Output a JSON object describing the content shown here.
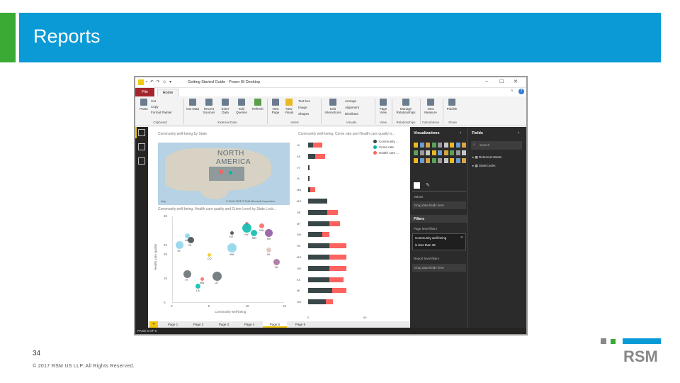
{
  "slide": {
    "title": "Reports",
    "page_number": "34",
    "copyright": "© 2017 RSM US LLP. All Rights Reserved.",
    "logo_text": "RSM",
    "colors": {
      "green": "#3aaa35",
      "blue": "#0a9ad6",
      "gray": "#888888"
    }
  },
  "app": {
    "window_title": "Getting Started Guide - Power BI Desktop",
    "tabs": {
      "file": "File",
      "home": "Home"
    },
    "ribbon": {
      "paste": "Paste",
      "cut": "Cut",
      "copy": "Copy",
      "format_painter": "Format Painter",
      "get_data": "Get Data",
      "recent_sources": "Recent Sources",
      "enter_data": "Enter Data",
      "edit_queries": "Edit Queries",
      "refresh": "Refresh",
      "new_page": "New Page",
      "new_visual": "New Visual",
      "text_box": "Text box",
      "image": "Image",
      "shapes": "Shapes",
      "edit_interactions": "Edit Interactions",
      "arrange": "Arrange",
      "alignment": "Alignment",
      "distribute": "Distribute",
      "page_view": "Page View",
      "manage_relationships": "Manage Relationships",
      "new_measure": "New Measure",
      "publish": "Publish",
      "groups": {
        "clipboard": "Clipboard",
        "external_data": "External Data",
        "insert": "Insert",
        "visuals": "Visuals",
        "view": "View",
        "relationships": "Relationships",
        "calculations": "Calculations",
        "share": "Share"
      }
    },
    "visuals": {
      "map_title": "Community well-being by State",
      "map_label": "NORTH AMERICA",
      "map_footer": "© 2016 HERE © 2016 Microsoft Corporation",
      "map_brand": "bing",
      "scatter_title": "Community well-being, Health care quality and Crime Level by State Lock...",
      "scatter_xlabel": "Community well-being",
      "scatter_ylabel": "Health care quality",
      "bar_title": "Community well-being, Crime rate and Health care quality b...",
      "legend": [
        "Community ...",
        "Crime rate",
        "Health care ..."
      ]
    },
    "page_tabs": [
      "Page 1",
      "Page 2",
      "Page 3",
      "Page 4",
      "Page 5",
      "Page 6"
    ],
    "status": "PAGE 5 OF 6",
    "viz_pane": {
      "title": "Visualizations",
      "values_label": "Values",
      "values_placeholder": "Drag data fields here",
      "filters_title": "Filters",
      "page_filters": "Page level filters",
      "filter_name": "Community well-being",
      "filter_condition": "is less than 36",
      "report_filters": "Report level filters",
      "report_placeholder": "Drag data fields here"
    },
    "fields_pane": {
      "title": "Fields",
      "search_placeholder": "Search",
      "tables": [
        "RetirementStats",
        "StateCodes"
      ]
    }
  },
  "chart_data": [
    {
      "type": "bar",
      "title": "Community well-being, Crime rate and Health care quality b...",
      "categories": [
        "HI",
        "AK",
        "VT",
        "IA",
        "MN",
        "MO",
        "DE",
        "MT",
        "WA",
        "PA",
        "MO",
        "OR",
        "KS",
        "MI",
        "WS"
      ],
      "series": [
        {
          "name": "Community ...",
          "color": "#3a4749",
          "values": [
            4,
            6,
            1,
            1,
            2,
            16,
            16,
            18,
            12,
            18,
            18,
            18,
            18,
            20,
            15
          ]
        },
        {
          "name": "Crime rate",
          "color": "#00b294",
          "values": [
            0,
            0,
            0,
            0,
            0,
            0,
            0,
            0,
            0,
            0,
            0,
            0,
            0,
            0,
            0
          ]
        },
        {
          "name": "Health care ...",
          "color": "#fd625e",
          "values": [
            8,
            8,
            0,
            0,
            4,
            0,
            9,
            9,
            6,
            14,
            14,
            14,
            12,
            12,
            6
          ]
        }
      ],
      "xlim": [
        0,
        50
      ],
      "ticks": [
        "0",
        "50"
      ]
    },
    {
      "type": "scatter",
      "title": "Community well-being, Health care quality and Crime Level by State Lock...",
      "xlabel": "Community well-being",
      "ylabel": "Health care quality",
      "xlim": [
        0,
        15
      ],
      "ylim": [
        0,
        36
      ],
      "xticks": [
        "0",
        "5",
        "10",
        "15"
      ],
      "yticks": [
        "0",
        "10",
        "20",
        "24",
        "36"
      ],
      "points": [
        {
          "label": "CA",
          "x": 10,
          "y": 33,
          "color": "#fd625e"
        },
        {
          "label": "MA",
          "x": 12,
          "y": 32,
          "color": "#fd625e"
        },
        {
          "label": "MD",
          "x": 11,
          "y": 29,
          "color": "#01b8aa"
        },
        {
          "label": "NV",
          "x": 13,
          "y": 29,
          "color": "#8a4f9e"
        },
        {
          "label": "NY",
          "x": 10,
          "y": 31,
          "color": "#01b8aa"
        },
        {
          "label": "NT",
          "x": 8,
          "y": 29,
          "color": "#374649"
        },
        {
          "label": "AK",
          "x": 2,
          "y": 28,
          "color": "#8ad4eb"
        },
        {
          "label": "ID",
          "x": 2.5,
          "y": 26,
          "color": "#374649"
        },
        {
          "label": "HI",
          "x": 1,
          "y": 24,
          "color": "#8ad4eb"
        },
        {
          "label": "WA",
          "x": 8,
          "y": 23,
          "color": "#8ad4eb"
        },
        {
          "label": "CO",
          "x": 5,
          "y": 20,
          "color": "#f2c80f"
        },
        {
          "label": "IN",
          "x": 13,
          "y": 22,
          "color": "#dfbfbf"
        },
        {
          "label": "VA",
          "x": 14,
          "y": 17,
          "color": "#a66999"
        },
        {
          "label": "VT",
          "x": 2,
          "y": 12,
          "color": "#5f6b6d"
        },
        {
          "label": "UT",
          "x": 6,
          "y": 11,
          "color": "#5f6b6d"
        },
        {
          "label": "MN",
          "x": 4,
          "y": 10,
          "color": "#fd625e"
        },
        {
          "label": "LA",
          "x": 3.5,
          "y": 7,
          "color": "#01b8aa"
        }
      ]
    }
  ]
}
